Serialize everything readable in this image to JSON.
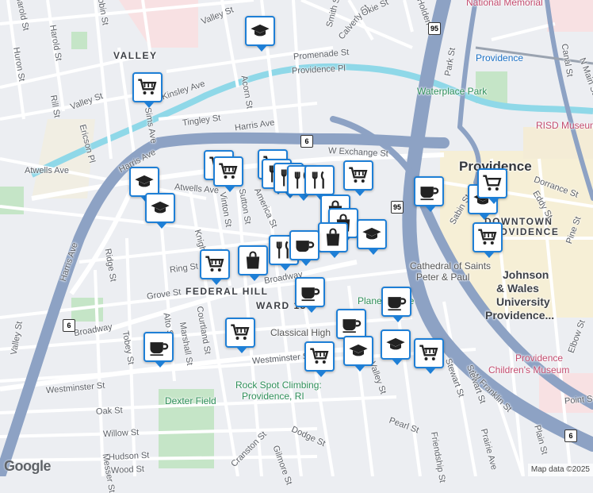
{
  "map": {
    "neighborhoods": [
      "VALLEY",
      "FEDERAL HILL",
      "WARD 15"
    ],
    "city": "Providence",
    "downtown": [
      "DOWNTOWN",
      "PROVIDENCE"
    ],
    "university": [
      "Johnson",
      "& Wales",
      "University",
      "Providence..."
    ],
    "streets": [
      "Valley St",
      "Harold St",
      "Robin St",
      "Huron St",
      "Rill St",
      "Valley St",
      "Kinsley Ave",
      "Sims Ave",
      "Ericson Pl",
      "Harris Ave",
      "Atwells Ave",
      "Harris Ave",
      "Acorn St",
      "Tingley St",
      "Harris Ave",
      "Promenade St",
      "Providence Pl",
      "W Exchange St",
      "Spruce St",
      "Atwells Ave",
      "Vinton St",
      "Sutton St",
      "America St",
      "Knight St",
      "Ring St",
      "Federal St",
      "Ridge St",
      "Grove St",
      "Broadway",
      "Broadway",
      "Harris Ave",
      "Valley St",
      "Tobey St",
      "Alto St",
      "Marshall St",
      "Courtland St",
      "Westminster St",
      "Westminster St",
      "Oak St",
      "Willow St",
      "Hudson St",
      "Wood St",
      "Cranston St",
      "Dodge St",
      "Pearl St",
      "Stewart St",
      "W Franklin St",
      "Prairie Ave",
      "Plain St",
      "Friendship St",
      "Dorrance St",
      "Eddy St",
      "Pine St",
      "Elbow St",
      "Canal St",
      "N Main St",
      "Park St",
      "Calverly St",
      "Holden St",
      "Okie St",
      "Smith St",
      "Sabin St",
      "Stewart St",
      "Point St",
      "Messer St",
      "Gilmore St",
      "Bridgham St"
    ],
    "pois": {
      "providence_station": "Providence",
      "waterplace": "Waterplace Park",
      "risd": "RISD Museum",
      "cathedral": [
        "Cathedral of Saints",
        "Peter & Paul"
      ],
      "plaza": "Plane Justice",
      "classical": "Classical High",
      "childrens": [
        "Providence",
        "Children's Museum"
      ],
      "rockspot": [
        "Rock Spot Climbing:",
        "Providence, RI"
      ],
      "dexter": "Dexter Field",
      "national_memorial": "National Memorial"
    },
    "highway_shields": [
      "6",
      "95",
      "95",
      "6",
      "6"
    ],
    "google_logo": "Google",
    "attribution": "Map data ©2025"
  },
  "markers": [
    {
      "type": "school",
      "icon": "school-icon"
    },
    {
      "type": "grocery",
      "icon": "shopping-cart-icon"
    },
    {
      "type": "school",
      "icon": "school-icon"
    },
    {
      "type": "school",
      "icon": "school-icon"
    },
    {
      "type": "grocery",
      "icon": "shopping-cart-icon"
    },
    {
      "type": "grocery",
      "icon": "shopping-cart-icon"
    },
    {
      "type": "grocery",
      "icon": "shopping-cart-icon"
    },
    {
      "type": "restaurant",
      "icon": "fork-knife-icon"
    },
    {
      "type": "restaurant",
      "icon": "fork-knife-icon"
    },
    {
      "type": "restaurant",
      "icon": "fork-knife-icon"
    },
    {
      "type": "grocery",
      "icon": "shopping-cart-icon"
    },
    {
      "type": "shopping",
      "icon": "shopping-bag-icon"
    },
    {
      "type": "shopping",
      "icon": "shopping-bag-icon"
    },
    {
      "type": "school",
      "icon": "school-icon"
    },
    {
      "type": "cafe",
      "icon": "coffee-cup-icon"
    },
    {
      "type": "school",
      "icon": "school-icon"
    },
    {
      "type": "grocery",
      "icon": "shopping-cart-icon"
    },
    {
      "type": "grocery",
      "icon": "shopping-cart-icon"
    },
    {
      "type": "shopping",
      "icon": "shopping-bag-icon"
    },
    {
      "type": "restaurant",
      "icon": "fork-knife-icon"
    },
    {
      "type": "cafe",
      "icon": "coffee-cup-icon"
    },
    {
      "type": "cafe",
      "icon": "coffee-cup-icon"
    },
    {
      "type": "cafe",
      "icon": "coffee-cup-icon"
    },
    {
      "type": "cafe",
      "icon": "coffee-cup-icon"
    },
    {
      "type": "grocery",
      "icon": "shopping-cart-icon"
    },
    {
      "type": "cafe",
      "icon": "coffee-cup-icon"
    },
    {
      "type": "grocery",
      "icon": "shopping-cart-icon"
    },
    {
      "type": "school",
      "icon": "school-icon"
    },
    {
      "type": "school",
      "icon": "school-icon"
    },
    {
      "type": "grocery",
      "icon": "shopping-cart-icon"
    },
    {
      "type": "school",
      "icon": "school-icon"
    }
  ],
  "colors": {
    "pin_border": "#1e7fd6",
    "highway": "#8fa3c2",
    "water": "#8fd8e8",
    "park": "#c8e6c9",
    "downtown": "#f7edc8"
  }
}
